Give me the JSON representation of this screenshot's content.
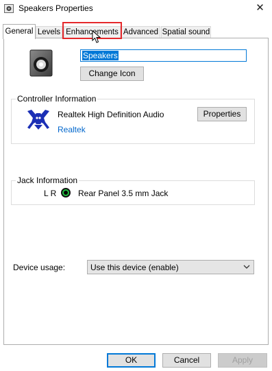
{
  "window": {
    "title": "Speakers Properties",
    "close_glyph": "✕"
  },
  "tabs": [
    {
      "label": "General",
      "active": true
    },
    {
      "label": "Levels"
    },
    {
      "label": "Enhancements",
      "highlighted": true
    },
    {
      "label": "Advanced"
    },
    {
      "label": "Spatial sound"
    }
  ],
  "device": {
    "name": "Speakers",
    "icon": "speaker-icon",
    "change_icon_label": "Change Icon"
  },
  "controller": {
    "group_label": "Controller Information",
    "name": "Realtek High Definition Audio",
    "vendor": "Realtek",
    "properties_label": "Properties",
    "icon": "realtek-icon"
  },
  "jack": {
    "group_label": "Jack Information",
    "channels": "L R",
    "description": "Rear Panel 3.5 mm Jack",
    "color": "#20c040"
  },
  "usage": {
    "label": "Device usage:",
    "selected": "Use this device (enable)"
  },
  "footer": {
    "ok_label": "OK",
    "cancel_label": "Cancel",
    "apply_label": "Apply"
  },
  "colors": {
    "accent": "#0078d7",
    "highlight_box": "#e5282b",
    "link": "#0066cc"
  }
}
